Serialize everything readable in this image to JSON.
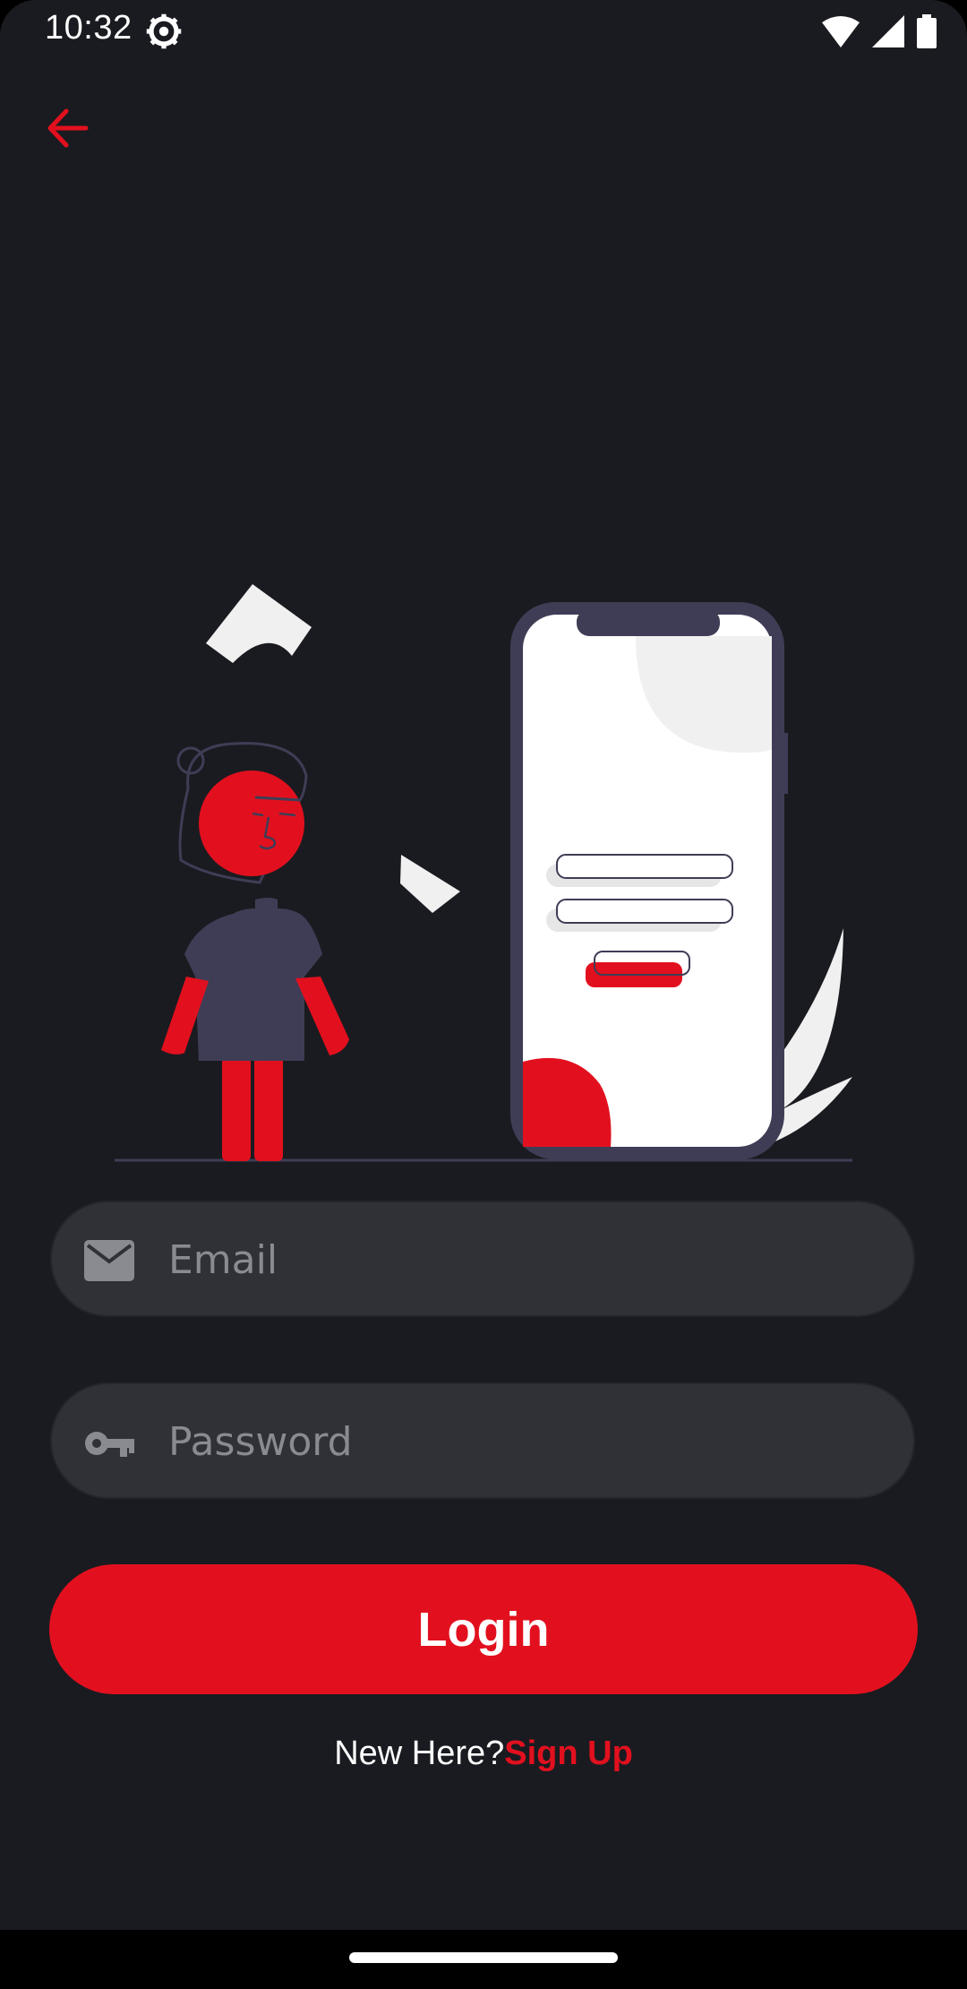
{
  "status_bar": {
    "time": "10:32",
    "icons": [
      "gear-icon",
      "wifi-icon",
      "signal-icon",
      "battery-icon"
    ]
  },
  "header": {
    "back_icon": "arrow-left-icon"
  },
  "illustration": {
    "description_icon": "person-phone-login-illustration"
  },
  "form": {
    "email": {
      "placeholder": "Email",
      "value": "",
      "icon": "envelope-icon"
    },
    "password": {
      "placeholder": "Password",
      "value": "",
      "icon": "key-icon"
    },
    "login_label": "Login",
    "signup_prompt": "New Here?",
    "signup_link": "Sign Up"
  },
  "colors": {
    "accent": "#e2101e",
    "background": "#1a1b20",
    "field_background": "#303137",
    "illustration_dark": "#3f3d56"
  }
}
